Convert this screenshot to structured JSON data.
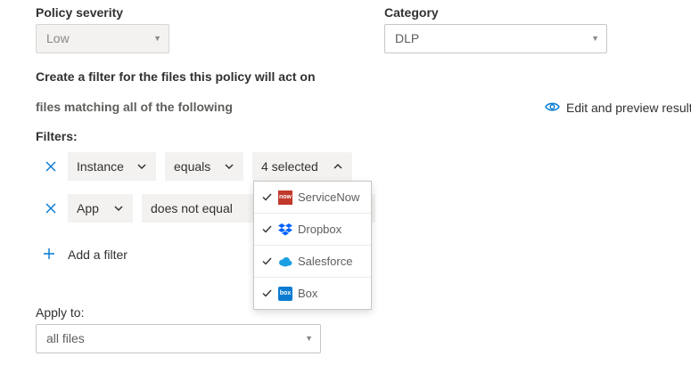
{
  "severity": {
    "label": "Policy severity",
    "value": "Low"
  },
  "category": {
    "label": "Category",
    "value": "DLP"
  },
  "filter_section": {
    "title": "Create a filter for the files this policy will act on",
    "matching_text": "files matching all of the following",
    "edit_preview_label": "Edit and preview result",
    "filters_label": "Filters:"
  },
  "filters": [
    {
      "field": "Instance",
      "operator": "equals",
      "value": "4 selected"
    },
    {
      "field": "App",
      "operator": "does not equal"
    }
  ],
  "dropdown": {
    "items": [
      {
        "name": "ServiceNow",
        "logo": "servicenow-logo",
        "logo_text": "now",
        "color": "#c0392b",
        "checked": true
      },
      {
        "name": "Dropbox",
        "logo": "dropbox-logo",
        "color": "#0061fe",
        "checked": true
      },
      {
        "name": "Salesforce",
        "logo": "salesforce-logo",
        "color": "#1ba0e2",
        "checked": true
      },
      {
        "name": "Box",
        "logo": "box-logo",
        "logo_text": "box",
        "color": "#0a7bd0",
        "checked": true
      }
    ]
  },
  "add_filter_label": "Add a filter",
  "apply_to": {
    "label": "Apply to:",
    "value": "all files"
  },
  "colors": {
    "accent": "#0078d4",
    "chip_bg": "#f3f2f1",
    "border": "#c8c6c4"
  }
}
